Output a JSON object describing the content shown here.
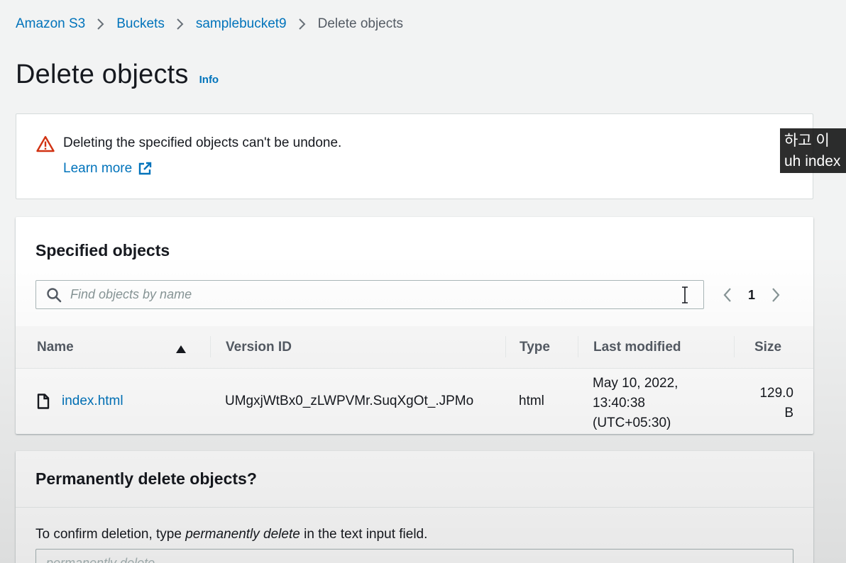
{
  "breadcrumb": {
    "items": [
      {
        "label": "Amazon S3"
      },
      {
        "label": "Buckets"
      },
      {
        "label": "samplebucket9"
      }
    ],
    "current": "Delete objects"
  },
  "page": {
    "title": "Delete objects",
    "info_label": "Info"
  },
  "alert": {
    "type": "warning",
    "message": "Deleting the specified objects can't be undone.",
    "link_label": "Learn more"
  },
  "specified_objects": {
    "title": "Specified objects",
    "search_placeholder": "Find objects by name",
    "page_number": "1",
    "columns": {
      "name": "Name",
      "version_id": "Version ID",
      "type": "Type",
      "last_modified": "Last modified",
      "size": "Size"
    },
    "sort": "ascending",
    "rows": [
      {
        "name": "index.html",
        "version_id": "UMgxjWtBx0_zLWPVMr.SuqXgOt_.JPMo",
        "type": "html",
        "last_modified": [
          "May 10, 2022,",
          "13:40:38",
          "(UTC+05:30)"
        ],
        "size": [
          "129.0",
          "B"
        ]
      }
    ]
  },
  "permanently_delete": {
    "title": "Permanently delete objects?",
    "confirm_prefix": "To confirm deletion, type ",
    "confirm_phrase": "permanently delete",
    "confirm_suffix": " in the text input field.",
    "input_placeholder": "permanently delete"
  },
  "caption": {
    "line1": "하고 이",
    "line2": "uh index"
  },
  "colors": {
    "link": "#0073bb",
    "warning": "#d13212",
    "background": "#f2f3f3",
    "text": "#16191f"
  }
}
